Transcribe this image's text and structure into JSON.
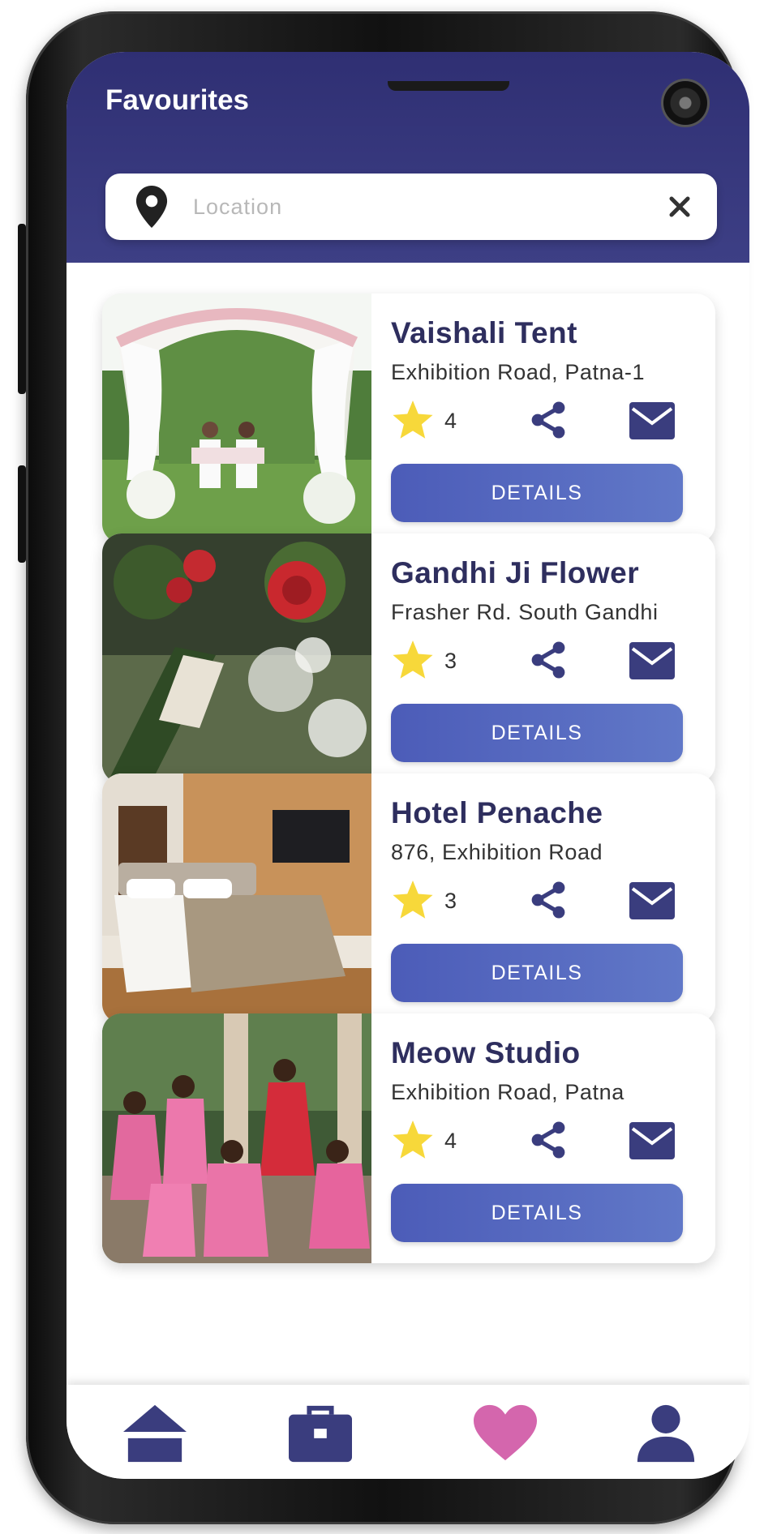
{
  "header": {
    "title": "Favourites"
  },
  "search": {
    "placeholder": "Location",
    "value": ""
  },
  "cards": [
    {
      "title": "Vaishali Tent",
      "address": "Exhibition Road, Patna-1",
      "rating": "4",
      "details_label": "DETAILS"
    },
    {
      "title": "Gandhi Ji Flower",
      "address": "Frasher Rd. South Gandhi",
      "rating": "3",
      "details_label": "DETAILS"
    },
    {
      "title": "Hotel Penache",
      "address": "876, Exhibition Road",
      "rating": "3",
      "details_label": "DETAILS"
    },
    {
      "title": "Meow Studio",
      "address": "Exhibition Road, Patna",
      "rating": "4",
      "details_label": "DETAILS"
    }
  ],
  "bottom_nav": {
    "items": [
      "home-icon",
      "briefcase-icon",
      "heart-icon",
      "profile-icon"
    ],
    "active": "heart-icon"
  },
  "colors": {
    "header": "#363878",
    "title": "#2e2e5e",
    "button": "#5567bd",
    "icon": "#3a3d7e",
    "star": "#f7d83a",
    "heart_active": "#d466ad"
  }
}
